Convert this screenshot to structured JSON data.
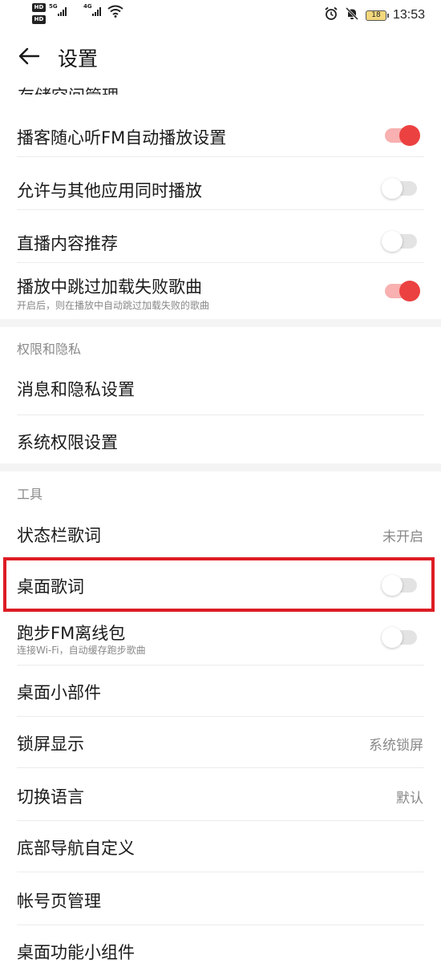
{
  "status_bar": {
    "hd1": "HD",
    "hd2": "HD",
    "net1": "5G",
    "net2": "4G",
    "battery": "18",
    "time": "13:53"
  },
  "header": {
    "title": "设置"
  },
  "partial_item": {
    "label": "存储空间管理"
  },
  "items_top": [
    {
      "label": "播客随心听FM自动播放设置",
      "toggle": "on"
    },
    {
      "label": "允许与其他应用同时播放",
      "toggle": "off"
    },
    {
      "label": "直播内容推荐",
      "toggle": "off"
    },
    {
      "label": "播放中跳过加载失败歌曲",
      "sub": "开启后，则在播放中自动跳过加载失败的歌曲",
      "toggle": "on"
    }
  ],
  "section_privacy": {
    "title": "权限和隐私",
    "items": [
      {
        "label": "消息和隐私设置"
      },
      {
        "label": "系统权限设置"
      }
    ]
  },
  "section_tools": {
    "title": "工具",
    "items": [
      {
        "label": "状态栏歌词",
        "value": "未开启"
      },
      {
        "label": "桌面歌词",
        "toggle": "off"
      },
      {
        "label": "跑步FM离线包",
        "sub": "连接Wi-Fi，自动缓存跑步歌曲",
        "toggle": "off"
      },
      {
        "label": "桌面小部件"
      },
      {
        "label": "锁屏显示",
        "value": "系统锁屏"
      },
      {
        "label": "切换语言",
        "value": "默认"
      },
      {
        "label": "底部导航自定义"
      },
      {
        "label": "帐号页管理"
      },
      {
        "label": "桌面功能小组件"
      }
    ]
  },
  "colors": {
    "accent": "#ec4141",
    "highlight_box": "#dd1c24"
  },
  "icons": [
    "back-arrow-icon",
    "alarm-icon",
    "mute-icon",
    "wifi-icon",
    "battery-icon",
    "signal-icon"
  ]
}
